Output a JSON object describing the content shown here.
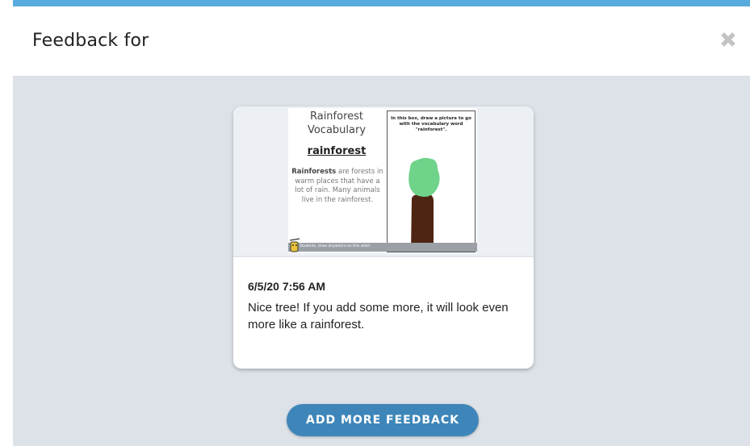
{
  "header": {
    "title": "Feedback for"
  },
  "colors": {
    "accent": "#5aabdd",
    "button": "#3e86b9",
    "background": "#dde2e9"
  },
  "card": {
    "slide": {
      "title": "Rainforest Vocabulary",
      "word": "rainforest",
      "definition_bold": "Rainforests",
      "definition_rest": " are forests in warm places that have a lot of rain. Many animals live in the rainforest.",
      "prompt": "In this box, draw a picture to go with the vocabulary word \"rainforest\".",
      "footer": "Students, draw anywhere on this slide!"
    },
    "feedback": {
      "timestamp": "6/5/20 7:56 AM",
      "text": "Nice tree! If you add some more, it will look even more like a rainforest."
    }
  },
  "actions": {
    "add_more_label": "ADD MORE FEEDBACK"
  },
  "icons": {
    "close": "close-icon"
  }
}
